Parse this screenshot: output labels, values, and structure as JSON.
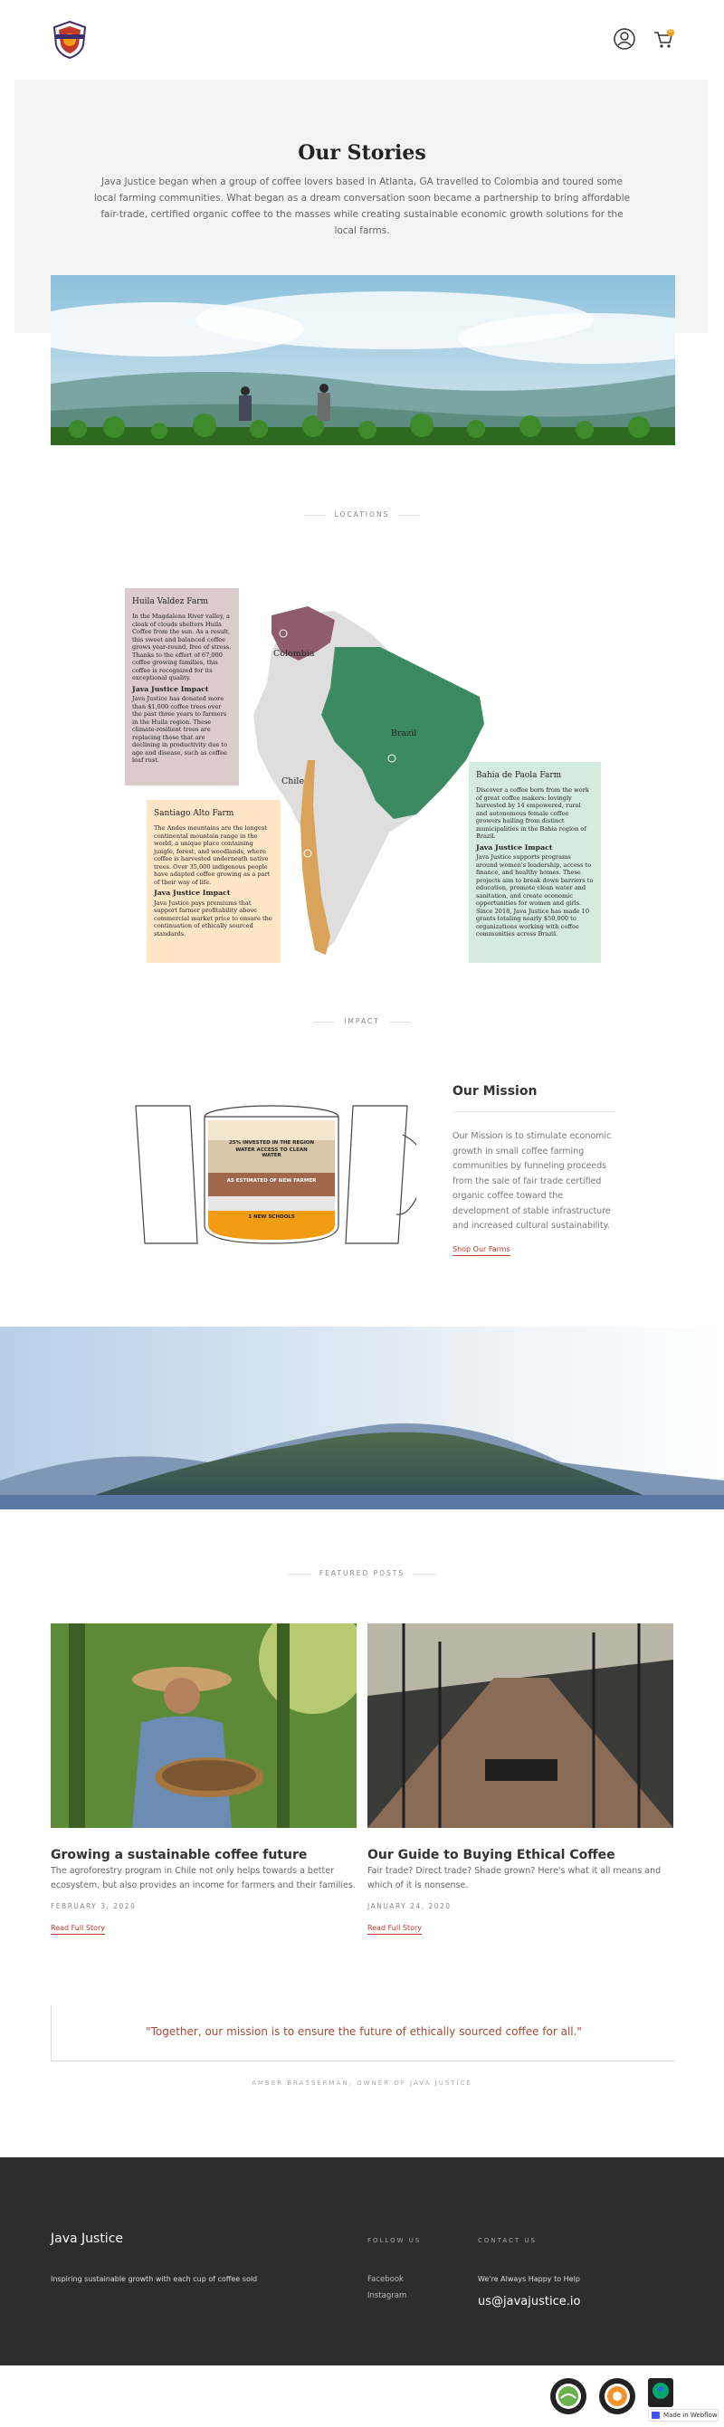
{
  "brand": {
    "logo_text": "JAVA JUSTICE"
  },
  "header": {
    "account_icon": "user-circle-icon",
    "cart_icon": "cart-icon",
    "cart_count": "0"
  },
  "hero": {
    "title": "Our Stories",
    "text": "Java Justice began when a group of coffee lovers based in Atlanta, GA travelled to Colombia and toured some local farming communities. What began as a dream conversation soon became a partnership to bring affordable fair-trade, certified organic coffee to the masses while creating sustainable economic growth solutions for the local farms."
  },
  "locations": {
    "label": "LOCATIONS",
    "countries": {
      "colombia": "Colombia",
      "brazil": "Brazil",
      "chile": "Chile"
    },
    "farms": [
      {
        "name": "Huila Valdez Farm",
        "description": "In the Magdalena River valley, a cloak of clouds shelters Huila Coffee from the sun. As a result, this sweet and balanced coffee grows year-round, free of stress. Thanks to the effort of 67,000 coffee growing families, this coffee is recognized for its exceptional quality.",
        "impact_title": "Java Justice Impact",
        "impact": "Java Justice has donated more than $1,000 coffee trees over the past three years to farmers in the Huila region. These climate-resilient trees are replacing those that are declining in productivity due to age and disease, such as coffee leaf rust.",
        "color": "#dccbcd"
      },
      {
        "name": "Santiago Alto Farm",
        "description": "The Andes mountains are the longest continental mountain range in the world, a unique place containing jungle, forest, and woodlands, where coffee is harvested underneath native trees. Over 35,000 indigenous people have adapted coffee growing as a part of their way of life.",
        "impact_title": "Java Justice Impact",
        "impact": "Java Justice pays premiums that support farmer profitability above commercial market price to ensure the continuation of ethically sourced standards.",
        "color": "#fde5c6"
      },
      {
        "name": "Bahia de Paola Farm",
        "description": "Discover a coffee born from the work of great coffee makers: lovingly harvested by 14 empowered, rural and autonomous female coffee growers hailing from distinct municipalities in the Bahia region of Brazil.",
        "impact_title": "Java Justice Impact",
        "impact": "Java Justice supports programs around women's leadership, access to finance, and healthy homes. These projects aim to break down barriers to education, promote clean water and sanitation, and create economic opportunities for women and girls. Since 2018, Java Justice has made 10 grants totaling nearly $50,000 to organizations working with coffee communities across Brazil.",
        "color": "#d6ebe0"
      }
    ]
  },
  "impact": {
    "label": "IMPACT",
    "mug_layers": [
      "25% INVESTED IN THE REGION",
      "WATER ACCESS TO CLEAN WATER",
      "AS ESTIMATED OF NEW FARMER",
      "1 NEW SCHOOLS"
    ],
    "mission_title": "Our Mission",
    "mission_text": "Our Mission is to stimulate economic growth in small coffee farming communities by funneling proceeds from the sale of fair trade certified organic coffee toward the development of stable infrastructure and increased cultural sustainability.",
    "mission_link": "Shop Our Farms"
  },
  "posts": {
    "label": "FEATURED POSTS",
    "items": [
      {
        "title": "Growing a sustainable coffee future",
        "excerpt": "The agroforestry program in Chile not only helps towards a better ecosystem, but also provides an income for farmers and their families.",
        "date": "FEBRUARY 3, 2020",
        "link": "Read Full Story"
      },
      {
        "title": "Our Guide to Buying Ethical Coffee",
        "excerpt": "Fair trade? Direct trade? Shade grown? Here's what it all means and which of it is nonsense.",
        "date": "JANUARY 24, 2020",
        "link": "Read Full Story"
      }
    ]
  },
  "quote": {
    "text": "\"Together, our mission is to ensure the future of ethically sourced coffee for all.\"",
    "author": "AMBER BRASSERMAN, OWNER OF JAVA JUSTICE"
  },
  "footer": {
    "brand": "Java Justice",
    "tagline": "Inspiring sustainable growth with each cup of coffee sold",
    "follow_head": "FOLLOW US",
    "facebook": "Facebook",
    "instagram": "Instagram",
    "contact_head": "CONTACT US",
    "contact_note": "We're Always Happy to Help",
    "email": "us@javajustice.io"
  },
  "badges": {
    "webflow": "Made in Webflow"
  }
}
